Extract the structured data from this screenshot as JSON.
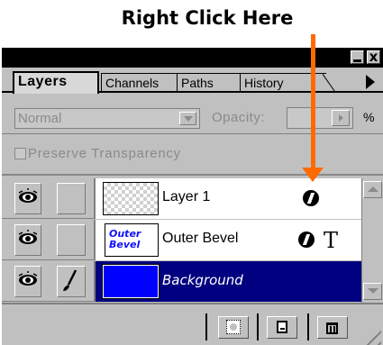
{
  "annotation": {
    "text": "Right Click Here",
    "arrow_color": "#ff6a00"
  },
  "window": {
    "minimize_label": "",
    "close_label": "x"
  },
  "tabs": [
    {
      "label": "Layers"
    },
    {
      "label": "Channels"
    },
    {
      "label": "Paths"
    },
    {
      "label": "History"
    }
  ],
  "options": {
    "blend_mode": "Normal",
    "opacity_label": "Opacity:",
    "opacity_value": "",
    "percent": "%",
    "preserve_label": "Preserve Transparency"
  },
  "layers": [
    {
      "name": "Layer 1",
      "thumb": "transparent-checker",
      "visible": true,
      "effects": [
        "fx-icon"
      ]
    },
    {
      "name": "Outer Bevel",
      "thumb": "outer-bevel-text",
      "thumb_text": "Outer Bevel",
      "visible": true,
      "effects": [
        "fx-icon",
        "type-layer-icon"
      ],
      "type_glyph": "T"
    },
    {
      "name": "Background",
      "thumb": "solid-blue",
      "visible": true,
      "active": true,
      "effects": []
    }
  ],
  "colors": {
    "selected_layer": "#000080",
    "background_thumb": "#0000ff",
    "panel": "#c0c0c0"
  },
  "footer": {
    "buttons": [
      "add-mask-icon",
      "new-layer-icon",
      "trash-icon"
    ]
  }
}
